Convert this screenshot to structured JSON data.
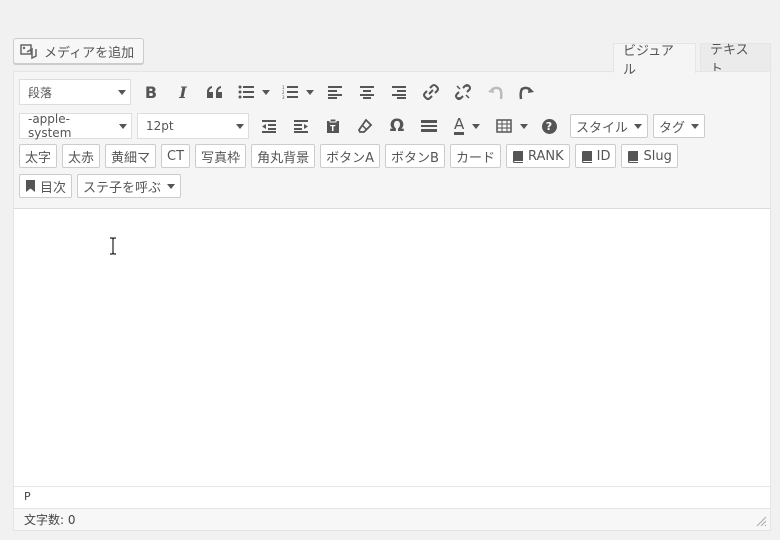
{
  "media_button": {
    "label": "メディアを追加",
    "icon": "media-icon"
  },
  "tabs": [
    {
      "label": "ビジュアル"
    },
    {
      "label": "テキスト"
    }
  ],
  "toolbar": {
    "format_select": "段落",
    "font_family_select": "-apple-system",
    "font_size_select": "12pt",
    "style_button": "スタイル",
    "tag_button": "タグ",
    "text_buttons": [
      "太字",
      "太赤",
      "黄細マ",
      "CT",
      "写真枠",
      "角丸背景",
      "ボタンA",
      "ボタンB",
      "カード"
    ],
    "bookmark_buttons": [
      "RANK",
      "ID",
      "Slug"
    ],
    "toc_button": "目次",
    "staff_select": "ステ子を呼ぶ",
    "bold_glyph": "B",
    "italic_glyph": "I",
    "omega_glyph": "Ω",
    "textcolor_glyph": "A",
    "help_glyph": "?"
  },
  "path": {
    "text": "P"
  },
  "status": {
    "word_count": "文字数: 0"
  }
}
